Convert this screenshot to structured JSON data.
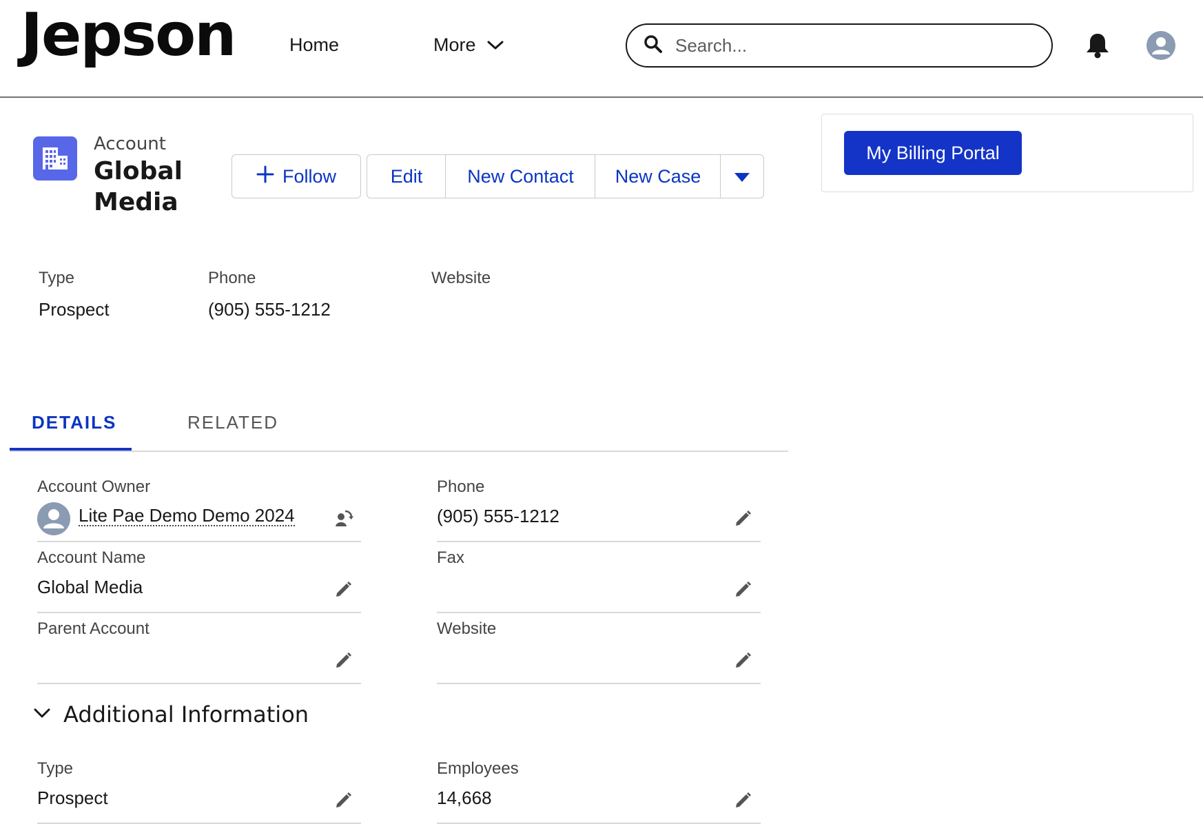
{
  "header": {
    "brand": "Jepson",
    "nav": {
      "home": "Home",
      "more": "More"
    },
    "search": {
      "placeholder": "Search..."
    }
  },
  "record": {
    "object_label": "Account",
    "name": "Global Media",
    "actions": {
      "follow": "Follow",
      "edit": "Edit",
      "new_contact": "New Contact",
      "new_case": "New Case"
    }
  },
  "billing": {
    "button_label": "My Billing Portal"
  },
  "highlights": [
    {
      "label": "Type",
      "value": "Prospect"
    },
    {
      "label": "Phone",
      "value": "(905) 555-1212"
    },
    {
      "label": "Website",
      "value": ""
    }
  ],
  "tabs": {
    "details": "DETAILS",
    "related": "RELATED"
  },
  "details": {
    "account_owner": {
      "label": "Account Owner",
      "value": "Lite Pae Demo Demo 2024"
    },
    "phone": {
      "label": "Phone",
      "value": "(905) 555-1212"
    },
    "account_name": {
      "label": "Account Name",
      "value": "Global Media"
    },
    "fax": {
      "label": "Fax",
      "value": ""
    },
    "parent_account": {
      "label": "Parent Account",
      "value": ""
    },
    "website": {
      "label": "Website",
      "value": ""
    }
  },
  "additional": {
    "title": "Additional Information",
    "type": {
      "label": "Type",
      "value": "Prospect"
    },
    "employees": {
      "label": "Employees",
      "value": "14,668"
    }
  },
  "colors": {
    "brand_blue": "#1434c8",
    "link_blue": "#0b34c2",
    "record_icon": "#5867e8",
    "avatar_gray": "#8a9bb2"
  },
  "icons": {
    "search": "search-icon",
    "bell": "bell-icon",
    "user": "user-avatar-icon",
    "building": "building-icon",
    "plus": "plus-icon",
    "caret": "caret-down-icon",
    "chevron": "chevron-down-icon",
    "pencil": "pencil-icon",
    "change_owner": "change-owner-icon"
  }
}
